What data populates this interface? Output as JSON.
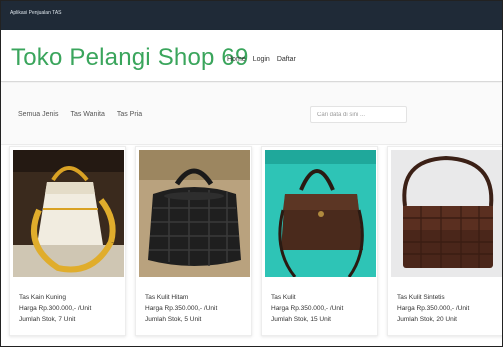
{
  "app": {
    "title": "Aplikasi Penjualan TAS"
  },
  "header": {
    "brand": "Toko Pelangi Shop 69",
    "nav": [
      "Home",
      "Login",
      "Daftar"
    ]
  },
  "filters": {
    "categories": [
      "Semua Jenis",
      "Tas Wanita",
      "Tas Pria"
    ],
    "search_placeholder": "Cari data di sini ..."
  },
  "products": [
    {
      "name": "Tas Kain Kuning",
      "price": "Harga Rp.300.000,- /Unit",
      "stock": "Jumlah Stok, 7 Unit"
    },
    {
      "name": "Tas Kulit Hitam",
      "price": "Harga Rp.350.000,- /Unit",
      "stock": "Jumlah Stok, 5 Unit"
    },
    {
      "name": "Tas Kulit",
      "price": "Harga Rp.350.000,- /Unit",
      "stock": "Jumlah Stok, 15 Unit"
    },
    {
      "name": "Tas Kulit Sintetis",
      "price": "Harga Rp.350.000,- /Unit",
      "stock": "Jumlah Stok, 20 Unit"
    }
  ],
  "colors": {
    "brand": "#3aa55c",
    "titlebar": "#1f2a37"
  }
}
